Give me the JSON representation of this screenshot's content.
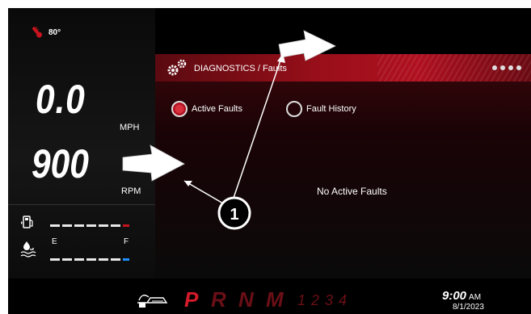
{
  "status": {
    "temperature": "80°"
  },
  "speed": {
    "value": "0.0",
    "unit": "MPH"
  },
  "engine": {
    "value": "900",
    "unit": "RPM"
  },
  "gauges": {
    "fuel_icon": "fuel-pump-icon",
    "coolant_icon": "coolant-level-icon",
    "empty_label": "E",
    "full_label": "F",
    "fuel_level_fraction": 0.0,
    "coolant_level_fraction": 0.0
  },
  "panel": {
    "title": "DIAGNOSTICS / Faults",
    "icon": "gears-icon",
    "page_dots": 4,
    "tabs": [
      {
        "label": "Active Faults",
        "selected": true
      },
      {
        "label": "Fault History",
        "selected": false
      }
    ],
    "message": "No Active Faults"
  },
  "gear_selector": {
    "icon": "parking-brake-icon",
    "gears": [
      "P",
      "R",
      "N",
      "M"
    ],
    "active_gear": "P",
    "numbers": [
      "1",
      "2",
      "3",
      "4"
    ]
  },
  "clock": {
    "time": "9:00",
    "ampm": "AM",
    "date": "8/1/2023"
  },
  "callout": {
    "label": "1"
  },
  "colors": {
    "accent": "#b01020",
    "active_gear": "#d51a2a",
    "inactive_gear": "#6a0f16",
    "coolant_full": "#1e90ff"
  }
}
